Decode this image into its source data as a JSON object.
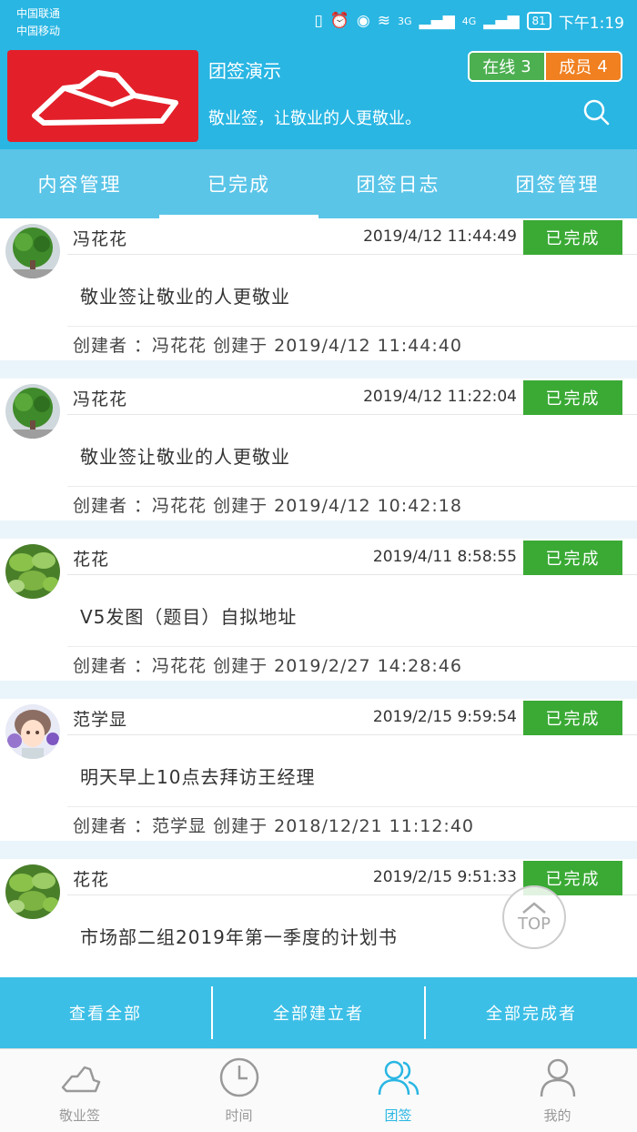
{
  "status_bar": {
    "carrier1": "中国联通",
    "carrier2": "中国移动",
    "sig3g": "3G",
    "sig4g": "4G",
    "battery": "81",
    "time": "下午1:19"
  },
  "header": {
    "team_name": "团签演示",
    "slogan": "敬业签，让敬业的人更敬业。",
    "online_label": "在线",
    "online_count": "3",
    "member_label": "成员",
    "member_count": "4"
  },
  "tabs": [
    {
      "label": "内容管理"
    },
    {
      "label": "已完成"
    },
    {
      "label": "团签日志"
    },
    {
      "label": "团签管理"
    }
  ],
  "items": [
    {
      "name": "冯花花",
      "time": "2019/4/12  11:44:49",
      "status": "已完成",
      "content": "敬业签让敬业的人更敬业",
      "creator": "创建者 ：冯花花 创建于 2019/4/12  11:44:40",
      "avatar": "tree"
    },
    {
      "name": "冯花花",
      "time": "2019/4/12  11:22:04",
      "status": "已完成",
      "content": "敬业签让敬业的人更敬业",
      "creator": "创建者 ：冯花花 创建于 2019/4/12  10:42:18",
      "avatar": "tree"
    },
    {
      "name": "花花",
      "time": "2019/4/11  8:58:55",
      "status": "已完成",
      "content": "V5发图（题目）自拟地址",
      "creator": "创建者 ：冯花花 创建于 2019/2/27  14:28:46",
      "avatar": "leaves"
    },
    {
      "name": "范学显",
      "time": "2019/2/15  9:59:54",
      "status": "已完成",
      "content": "明天早上10点去拜访王经理",
      "creator": "创建者 ：范学显 创建于 2018/12/21  11:12:40",
      "avatar": "anime"
    },
    {
      "name": "花花",
      "time": "2019/2/15  9:51:33",
      "status": "已完成",
      "content": "市场部二组2019年第一季度的计划书",
      "creator": "",
      "avatar": "leaves"
    }
  ],
  "top_button": "TOP",
  "actions": [
    {
      "label": "查看全部"
    },
    {
      "label": "全部建立者"
    },
    {
      "label": "全部完成者"
    }
  ],
  "nav": [
    {
      "label": "敬业签",
      "icon": "logo-icon"
    },
    {
      "label": "时间",
      "icon": "clock-icon"
    },
    {
      "label": "团签",
      "icon": "team-icon"
    },
    {
      "label": "我的",
      "icon": "user-icon"
    }
  ],
  "colors": {
    "primary": "#29b6e3",
    "tab_bar": "#5bc5e8",
    "done_badge": "#3aaa35",
    "online": "#4caf50",
    "member": "#f08020",
    "logo_bg": "#e3202a"
  }
}
